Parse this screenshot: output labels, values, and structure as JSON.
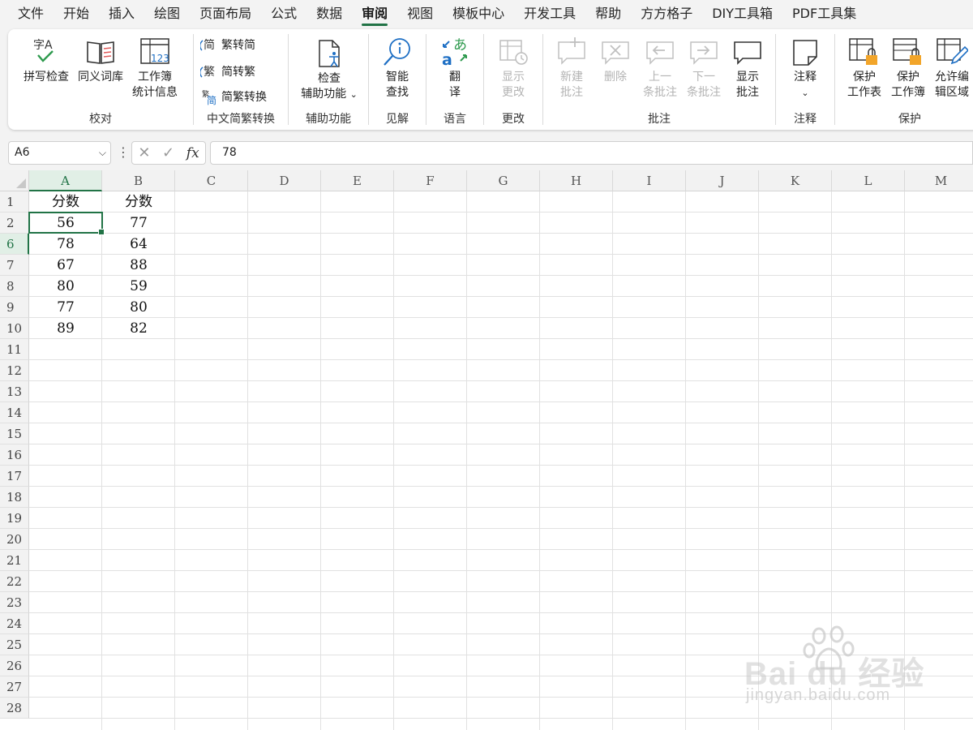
{
  "menu": {
    "tabs": [
      {
        "label": "文件"
      },
      {
        "label": "开始"
      },
      {
        "label": "插入"
      },
      {
        "label": "绘图"
      },
      {
        "label": "页面布局"
      },
      {
        "label": "公式"
      },
      {
        "label": "数据"
      },
      {
        "label": "审阅",
        "active": true
      },
      {
        "label": "视图"
      },
      {
        "label": "模板中心"
      },
      {
        "label": "开发工具"
      },
      {
        "label": "帮助"
      },
      {
        "label": "方方格子"
      },
      {
        "label": "DIY工具箱"
      },
      {
        "label": "PDF工具集"
      }
    ]
  },
  "ribbon": {
    "proofing": {
      "label": "校对",
      "spell_check": "拼写检查",
      "thesaurus": "同义词库",
      "workbook_stats_line1": "工作簿",
      "workbook_stats_line2": "统计信息"
    },
    "chinese_conversion": {
      "label": "中文简繁转换",
      "to_simplified": "繁转简",
      "to_traditional": "简转繁",
      "convert": "简繁转换"
    },
    "accessibility": {
      "label": "辅助功能",
      "check_line1": "检查",
      "check_line2": "辅助功能"
    },
    "insights": {
      "label": "见解",
      "smart_lookup_line1": "智能",
      "smart_lookup_line2": "查找"
    },
    "language": {
      "label": "语言",
      "translate_line1": "翻",
      "translate_line2": "译"
    },
    "changes": {
      "label": "更改",
      "show_changes_line1": "显示",
      "show_changes_line2": "更改"
    },
    "comments": {
      "label": "批注",
      "new_line1": "新建",
      "new_line2": "批注",
      "delete": "删除",
      "prev_line1": "上一",
      "prev_line2": "条批注",
      "next_line1": "下一",
      "next_line2": "条批注",
      "show_line1": "显示",
      "show_line2": "批注"
    },
    "notes": {
      "label": "注释",
      "notes_btn": "注释"
    },
    "protect": {
      "label": "保护",
      "sheet_line1": "保护",
      "sheet_line2": "工作表",
      "workbook_line1": "保护",
      "workbook_line2": "工作簿",
      "ranges_line1": "允许编",
      "ranges_line2": "辑区域"
    }
  },
  "formula_bar": {
    "name_box": "A6",
    "cancel_glyph": "✕",
    "enter_glyph": "✓",
    "fx_glyph": "fx",
    "formula": "78"
  },
  "sheet": {
    "columns": [
      "A",
      "B",
      "C",
      "D",
      "E",
      "F",
      "G",
      "H",
      "I",
      "J",
      "K",
      "L",
      "M"
    ],
    "selected_column": "A",
    "row_numbers": [
      "1",
      "2",
      "6",
      "7",
      "8",
      "9",
      "10",
      "11",
      "12",
      "13",
      "14",
      "15",
      "16",
      "17",
      "18",
      "19",
      "20",
      "21",
      "22",
      "23",
      "24",
      "25",
      "26",
      "27",
      "28"
    ],
    "selected_row": "6",
    "data": {
      "header": [
        "分数",
        "分数"
      ],
      "rows": [
        [
          "56",
          "77"
        ],
        [
          "78",
          "64"
        ],
        [
          "67",
          "88"
        ],
        [
          "80",
          "59"
        ],
        [
          "77",
          "80"
        ],
        [
          "89",
          "82"
        ]
      ]
    }
  },
  "watermark": {
    "logo_text": "Bai du 经验",
    "url": "jingyan.baidu.com"
  },
  "colors": {
    "accent": "#217346",
    "ribbon_icon_blue": "#1e6fc4",
    "lock_orange": "#f2a52a",
    "disabled": "#b3b3b3"
  }
}
